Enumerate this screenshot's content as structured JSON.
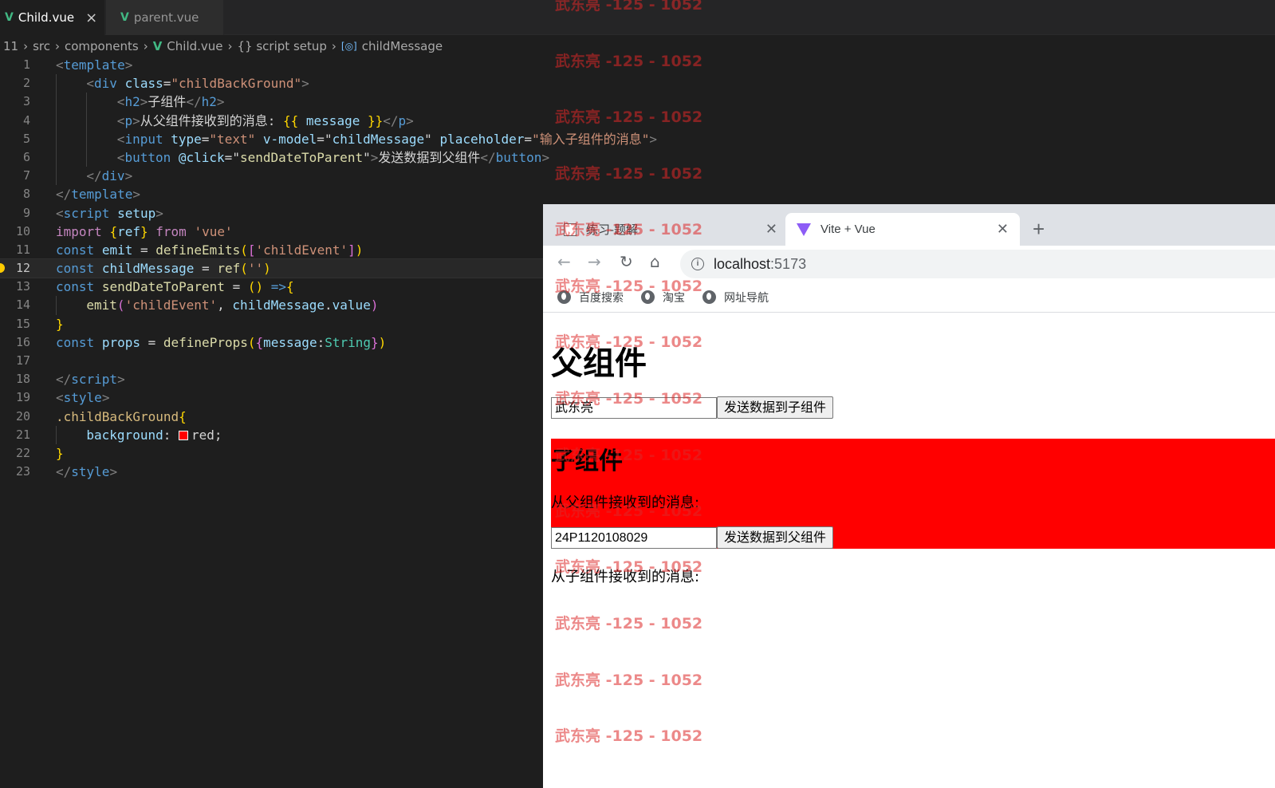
{
  "editor": {
    "tabs": [
      {
        "label": "Child.vue",
        "active": true
      },
      {
        "label": "parent.vue",
        "active": false
      }
    ],
    "breadcrumb": [
      "11",
      "src",
      "components",
      "Child.vue",
      "{} script setup",
      "childMessage"
    ],
    "line_numbers": [
      "1",
      "2",
      "3",
      "4",
      "5",
      "6",
      "7",
      "8",
      "9",
      "10",
      "11",
      "12",
      "13",
      "14",
      "15",
      "16",
      "17",
      "18",
      "19",
      "20",
      "21",
      "22",
      "23"
    ],
    "current_line": "12",
    "lines": [
      [
        [
          "tg",
          "<"
        ],
        [
          "tn",
          "template"
        ],
        [
          "tg",
          ">"
        ]
      ],
      [
        [
          "tg",
          "<"
        ],
        [
          "tn",
          "div"
        ],
        [
          "wh",
          " "
        ],
        [
          "an",
          "class"
        ],
        [
          "wh",
          "="
        ],
        [
          "av",
          "\"childBackGround\""
        ],
        [
          "tg",
          ">"
        ]
      ],
      [
        [
          "tg",
          "<"
        ],
        [
          "tn",
          "h2"
        ],
        [
          "tg",
          ">"
        ],
        [
          "wh",
          "子组件"
        ],
        [
          "tg",
          "</"
        ],
        [
          "tn",
          "h2"
        ],
        [
          "tg",
          ">"
        ]
      ],
      [
        [
          "tg",
          "<"
        ],
        [
          "tn",
          "p"
        ],
        [
          "tg",
          ">"
        ],
        [
          "wh",
          "从父组件接收到的消息: "
        ],
        [
          "b1",
          "{{"
        ],
        [
          "wh",
          " "
        ],
        [
          "vr",
          "message"
        ],
        [
          "wh",
          " "
        ],
        [
          "b1",
          "}}"
        ],
        [
          "tg",
          "</"
        ],
        [
          "tn",
          "p"
        ],
        [
          "tg",
          ">"
        ]
      ],
      [
        [
          "tg",
          "<"
        ],
        [
          "tn",
          "input"
        ],
        [
          "wh",
          " "
        ],
        [
          "an",
          "type"
        ],
        [
          "wh",
          "="
        ],
        [
          "av",
          "\"text\""
        ],
        [
          "wh",
          " "
        ],
        [
          "an",
          "v-model"
        ],
        [
          "wh",
          "="
        ],
        [
          "wh",
          "\""
        ],
        [
          "vr",
          "childMessage"
        ],
        [
          "wh",
          "\""
        ],
        [
          "wh",
          " "
        ],
        [
          "an",
          "placeholder"
        ],
        [
          "wh",
          "="
        ],
        [
          "av",
          "\"输入子组件的消息\""
        ],
        [
          "tg",
          ">"
        ]
      ],
      [
        [
          "tg",
          "<"
        ],
        [
          "tn",
          "button"
        ],
        [
          "wh",
          " "
        ],
        [
          "an",
          "@click"
        ],
        [
          "wh",
          "="
        ],
        [
          "wh",
          "\""
        ],
        [
          "fn",
          "sendDateToParent"
        ],
        [
          "wh",
          "\""
        ],
        [
          "tg",
          ">"
        ],
        [
          "wh",
          "发送数据到父组件"
        ],
        [
          "tg",
          "</"
        ],
        [
          "tn",
          "button"
        ],
        [
          "tg",
          ">"
        ]
      ],
      [
        [
          "tg",
          "</"
        ],
        [
          "tn",
          "div"
        ],
        [
          "tg",
          ">"
        ]
      ],
      [
        [
          "tg",
          "</"
        ],
        [
          "tn",
          "template"
        ],
        [
          "tg",
          ">"
        ]
      ],
      [
        [
          "tg",
          "<"
        ],
        [
          "tn",
          "script"
        ],
        [
          "wh",
          " "
        ],
        [
          "an",
          "setup"
        ],
        [
          "tg",
          ">"
        ]
      ],
      [
        [
          "kc",
          "import"
        ],
        [
          "wh",
          " "
        ],
        [
          "b1",
          "{"
        ],
        [
          "vr",
          "ref"
        ],
        [
          "b1",
          "}"
        ],
        [
          "wh",
          " "
        ],
        [
          "kc",
          "from"
        ],
        [
          "wh",
          " "
        ],
        [
          "st",
          "'vue'"
        ]
      ],
      [
        [
          "kw",
          "const"
        ],
        [
          "wh",
          " "
        ],
        [
          "vr",
          "emit"
        ],
        [
          "wh",
          " = "
        ],
        [
          "fn",
          "defineEmits"
        ],
        [
          "b1",
          "("
        ],
        [
          "b2",
          "["
        ],
        [
          "st",
          "'childEvent'"
        ],
        [
          "b2",
          "]"
        ],
        [
          "b1",
          ")"
        ]
      ],
      [
        [
          "kw",
          "const"
        ],
        [
          "wh",
          " "
        ],
        [
          "vr",
          "childMessage"
        ],
        [
          "wh",
          " = "
        ],
        [
          "fn",
          "ref"
        ],
        [
          "b1",
          "("
        ],
        [
          "st",
          "''"
        ],
        [
          "b1",
          ")"
        ]
      ],
      [
        [
          "kw",
          "const"
        ],
        [
          "wh",
          " "
        ],
        [
          "fn",
          "sendDateToParent"
        ],
        [
          "wh",
          " = "
        ],
        [
          "b1",
          "()"
        ],
        [
          "wh",
          " "
        ],
        [
          "kw",
          "=>"
        ],
        [
          "b1",
          "{"
        ]
      ],
      [
        [
          "fn",
          "emit"
        ],
        [
          "b2",
          "("
        ],
        [
          "st",
          "'childEvent'"
        ],
        [
          "wh",
          ", "
        ],
        [
          "vr",
          "childMessage"
        ],
        [
          "wh",
          "."
        ],
        [
          "vr",
          "value"
        ],
        [
          "b2",
          ")"
        ]
      ],
      [
        [
          "b1",
          "}"
        ]
      ],
      [
        [
          "kw",
          "const"
        ],
        [
          "wh",
          " "
        ],
        [
          "vr",
          "props"
        ],
        [
          "wh",
          " = "
        ],
        [
          "fn",
          "defineProps"
        ],
        [
          "b1",
          "("
        ],
        [
          "b2",
          "{"
        ],
        [
          "pr",
          "message"
        ],
        [
          "wh",
          ":"
        ],
        [
          "ty",
          "String"
        ],
        [
          "b2",
          "}"
        ],
        [
          "b1",
          ")"
        ]
      ],
      [],
      [
        [
          "tg",
          "</"
        ],
        [
          "tn",
          "script"
        ],
        [
          "tg",
          ">"
        ]
      ],
      [
        [
          "tg",
          "<"
        ],
        [
          "tn",
          "style"
        ],
        [
          "tg",
          ">"
        ]
      ],
      [
        [
          "cs",
          ".childBackGround"
        ],
        [
          "b1",
          "{"
        ]
      ],
      [
        [
          "pr",
          "background"
        ],
        [
          "wh",
          ": "
        ],
        [
          "swatch",
          ""
        ],
        [
          "wh",
          "red;"
        ]
      ],
      [
        [
          "b1",
          "}"
        ]
      ],
      [
        [
          "tg",
          "</"
        ],
        [
          "tn",
          "style"
        ],
        [
          "tg",
          ">"
        ]
      ]
    ]
  },
  "browser": {
    "tabs": [
      {
        "label": "练习-题解",
        "active": false,
        "icon": "book-icon"
      },
      {
        "label": "Vite + Vue",
        "active": true,
        "icon": "vite-icon"
      }
    ],
    "close_glyph": "✕",
    "new_tab_glyph": "+",
    "url_host": "localhost",
    "url_port": ":5173",
    "bookmarks": [
      "百度搜索",
      "淘宝",
      "网址导航"
    ],
    "page": {
      "parent_title": "父组件",
      "parent_input_value": "武东亮",
      "parent_button": "发送数据到子组件",
      "child_title": "子组件",
      "child_received_label": "从父组件接收到的消息:",
      "child_input_value": "24P1120108029",
      "child_button": "发送数据到父组件",
      "parent_received_label": "从子组件接收到的消息:"
    }
  },
  "watermark": {
    "text": "武东亮 -125 - 1052",
    "color": "#dc2828"
  }
}
